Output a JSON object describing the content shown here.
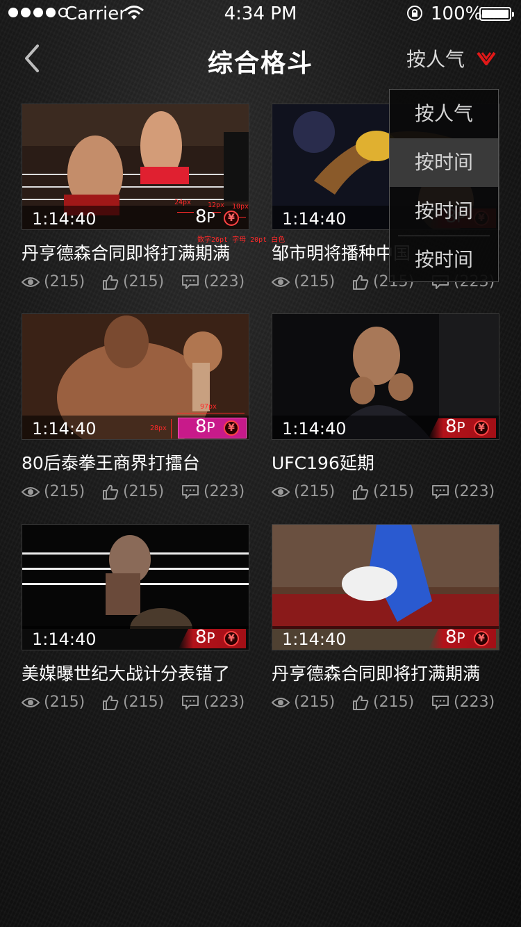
{
  "status_bar": {
    "carrier": "Carrier",
    "time": "4:34 PM",
    "battery": "100%"
  },
  "nav": {
    "title": "综合格斗",
    "sort_label": "按人气"
  },
  "sort_menu": {
    "items": [
      "按人气",
      "按时间",
      "按时间",
      "按时间"
    ],
    "active_index": 1
  },
  "videos": [
    {
      "title": "丹亨德森合同即将打满期满",
      "duration": "1:14:40",
      "price": "8",
      "price_unit": "P",
      "views": "(215)",
      "likes": "(215)",
      "comments": "(223)"
    },
    {
      "title": "邹市明将播种中国",
      "duration": "1:14:40",
      "price": "8",
      "price_unit": "P",
      "views": "(215)",
      "likes": "(215)",
      "comments": "(223)"
    },
    {
      "title": "80后泰拳王商界打擂台",
      "duration": "1:14:40",
      "price": "8",
      "price_unit": "P",
      "views": "(215)",
      "likes": "(215)",
      "comments": "(223)"
    },
    {
      "title": "UFC196延期",
      "duration": "1:14:40",
      "price": "8",
      "price_unit": "P",
      "views": "(215)",
      "likes": "(215)",
      "comments": "(223)"
    },
    {
      "title": "美媒曝世纪大战计分表错了",
      "duration": "1:14:40",
      "price": "8",
      "price_unit": "P",
      "views": "(215)",
      "likes": "(215)",
      "comments": "(223)"
    },
    {
      "title": "丹亨德森合同即将打满期满",
      "duration": "1:14:40",
      "price": "8",
      "price_unit": "P",
      "views": "(215)",
      "likes": "(215)",
      "comments": "(223)"
    }
  ],
  "annotations": {
    "w24": "24px",
    "w12": "12px",
    "w10": "10px",
    "font_spec": "数字26pt 字母 20pt 白色",
    "w97": "97px",
    "h28": "28px"
  },
  "icons": {
    "views": "eye-icon",
    "likes": "thumb-up-icon",
    "comments": "comment-icon",
    "currency": "yen-icon"
  },
  "colors": {
    "accent": "#c8121b",
    "annotation": "#ff2a2a",
    "highlight": "#c81a8a"
  }
}
